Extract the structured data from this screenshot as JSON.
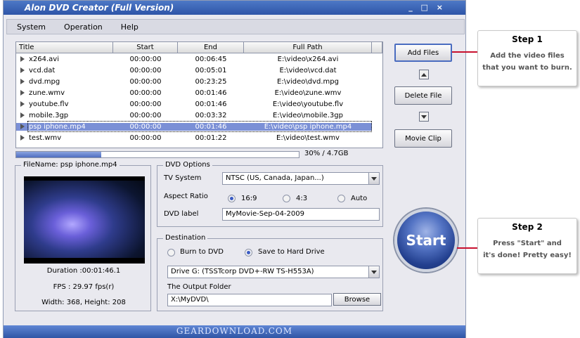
{
  "window": {
    "title": "Alon DVD Creator (Full Version)",
    "controls": "_ □ ×"
  },
  "menu": [
    "System",
    "Operation",
    "Help"
  ],
  "file_list": {
    "headers": [
      "Title",
      "Start",
      "End",
      "Full Path"
    ],
    "rows": [
      {
        "title": "x264.avi",
        "start": "00:00:00",
        "end": "00:06:45",
        "path": "E:\\video\\x264.avi"
      },
      {
        "title": "vcd.dat",
        "start": "00:00:00",
        "end": "00:05:01",
        "path": "E:\\video\\vcd.dat"
      },
      {
        "title": "dvd.mpg",
        "start": "00:00:00",
        "end": "00:23:25",
        "path": "E:\\video\\dvd.mpg"
      },
      {
        "title": "zune.wmv",
        "start": "00:00:00",
        "end": "00:01:46",
        "path": "E:\\video\\zune.wmv"
      },
      {
        "title": "youtube.flv",
        "start": "00:00:00",
        "end": "00:01:46",
        "path": "E:\\video\\youtube.flv"
      },
      {
        "title": "mobile.3gp",
        "start": "00:00:00",
        "end": "00:03:32",
        "path": "E:\\video\\mobile.3gp"
      },
      {
        "title": "psp iphone.mp4",
        "start": "00:00:00",
        "end": "00:01:46",
        "path": "E:\\video\\psp iphone.mp4",
        "selected": true
      },
      {
        "title": "test.wmv",
        "start": "00:00:00",
        "end": "00:01:22",
        "path": "E:\\video\\test.wmv"
      }
    ]
  },
  "progress": {
    "fraction": 0.3,
    "text": "30% / 4.7GB"
  },
  "buttons": {
    "add_files": "Add Files",
    "delete_file": "Delete File",
    "movie_clip": "Movie Clip",
    "browse": "Browse",
    "start": "Start"
  },
  "file_info": {
    "legend": "FileName: psp iphone.mp4",
    "duration": "Duration :00:01:46.1",
    "fps": "FPS : 29.97 fps(r)",
    "size": "Width: 368, Height: 208"
  },
  "dvd_options": {
    "legend": "DVD Options",
    "tv_system_label": "TV System",
    "tv_system_value": "NTSC (US, Canada, Japan...)",
    "aspect_label": "Aspect Ratio",
    "aspect_options": [
      "16:9",
      "4:3",
      "Auto"
    ],
    "aspect_selected": "16:9",
    "dvd_label_label": "DVD label",
    "dvd_label_value": "MyMovie-Sep-04-2009"
  },
  "destination": {
    "legend": "Destination",
    "options": [
      "Burn to DVD",
      "Save to Hard Drive"
    ],
    "selected": "Save to Hard Drive",
    "drive_value": "Drive G: (TSSTcorp DVD+-RW TS-H553A)",
    "output_label": "The Output Folder",
    "output_value": "X:\\MyDVD\\"
  },
  "footer": "GEARDOWNLOAD.COM",
  "callouts": [
    {
      "head": "Step 1",
      "lines": [
        "Add the video files",
        "that you want to burn."
      ]
    },
    {
      "head": "Step 2",
      "lines": [
        "Press \"Start\" and",
        "it's done! Pretty easy!"
      ]
    }
  ],
  "colors": {
    "accent": "#3b5cc4",
    "connector": "#c8102e",
    "selection": "#7b90d6"
  }
}
